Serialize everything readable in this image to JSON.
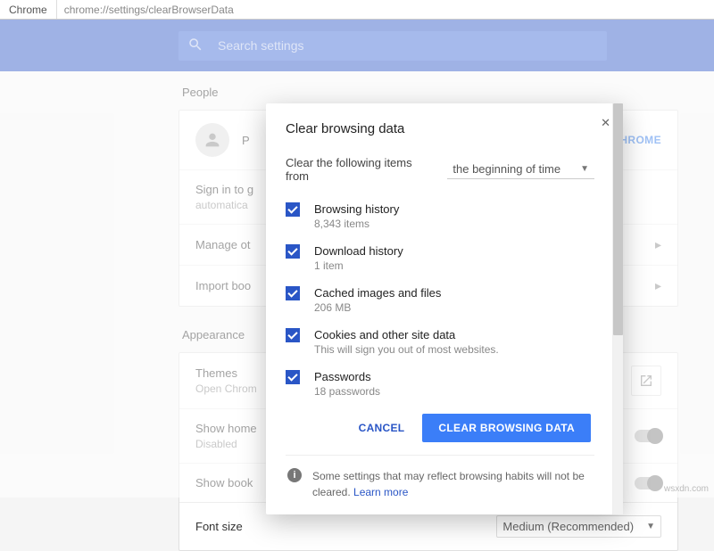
{
  "address_bar": {
    "brand": "Chrome",
    "url": "chrome://settings/clearBrowserData"
  },
  "search_placeholder": "Search settings",
  "sections": {
    "people": {
      "header": "People",
      "signin_hint": "Sign in to g",
      "signin_sub": "automatica",
      "signin_link": "D CHROME",
      "person_label": "P",
      "rows": {
        "manage": "Manage ot",
        "import": "Import boo"
      }
    },
    "appearance": {
      "header": "Appearance",
      "themes": {
        "title": "Themes",
        "sub": "Open Chrom"
      },
      "show_home": {
        "title": "Show home",
        "sub": "Disabled"
      },
      "show_book": {
        "title": "Show book"
      },
      "font": {
        "title": "Font size",
        "value": "Medium (Recommended)"
      }
    }
  },
  "dialog": {
    "title": "Clear browsing data",
    "clear_from_label": "Clear the following items from",
    "time_range": "the beginning of time",
    "options": [
      {
        "title": "Browsing history",
        "sub": "8,343 items"
      },
      {
        "title": "Download history",
        "sub": "1 item"
      },
      {
        "title": "Cached images and files",
        "sub": "206 MB"
      },
      {
        "title": "Cookies and other site data",
        "sub": "This will sign you out of most websites."
      },
      {
        "title": "Passwords",
        "sub": "18 passwords"
      }
    ],
    "cancel": "CANCEL",
    "confirm": "CLEAR BROWSING DATA",
    "notice_text": "Some settings that may reflect browsing habits will not be cleared.  ",
    "notice_link": "Learn more"
  },
  "watermark": "wsxdn.com"
}
